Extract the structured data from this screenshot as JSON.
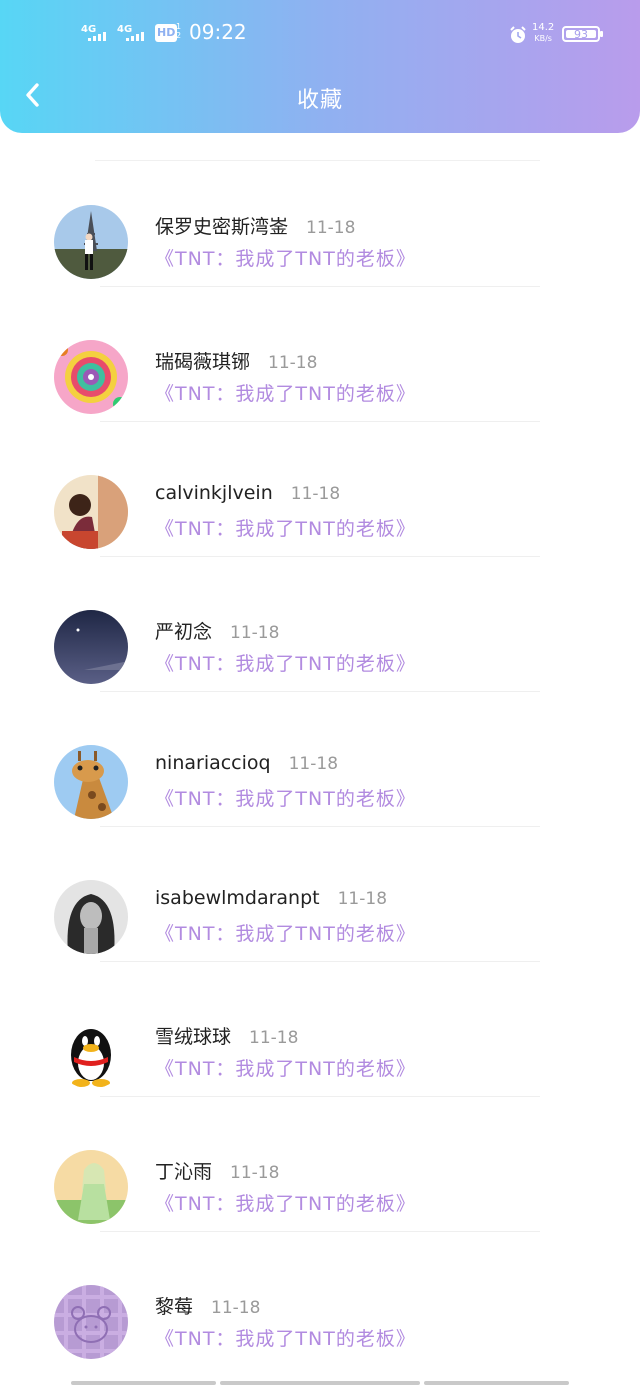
{
  "status_bar": {
    "signal1": "4G",
    "signal2": "4G",
    "hd": "HD",
    "hd_sub": "1\n2",
    "time": "09:22",
    "speed_value": "14.2",
    "speed_unit": "KB/s",
    "battery": "93"
  },
  "header": {
    "title": "收藏"
  },
  "items": [
    {
      "name": "保罗史密斯湾崟",
      "date": "11-18",
      "book": "《TNT：我成了TNT的老板》",
      "avatar": "eiffel-tower-photo"
    },
    {
      "name": "瑞碣薇琪铘",
      "date": "11-18",
      "book": "《TNT：我成了TNT的老板》",
      "avatar": "lollipop-photo"
    },
    {
      "name": "calvinkjlvein",
      "date": "11-18",
      "book": "《TNT：我成了TNT的老板》",
      "avatar": "girl-reading-photo"
    },
    {
      "name": "严初念",
      "date": "11-18",
      "book": "《TNT：我成了TNT的老板》",
      "avatar": "night-sky-photo"
    },
    {
      "name": "ninariaccioq",
      "date": "11-18",
      "book": "《TNT：我成了TNT的老板》",
      "avatar": "giraffe-photo"
    },
    {
      "name": "isabewlmdaranpt",
      "date": "11-18",
      "book": "《TNT：我成了TNT的老板》",
      "avatar": "bw-woman-photo"
    },
    {
      "name": "雪绒球球",
      "date": "11-18",
      "book": "《TNT：我成了TNT的老板》",
      "avatar": "qq-penguin-icon"
    },
    {
      "name": "丁沁雨",
      "date": "11-18",
      "book": "《TNT：我成了TNT的老板》",
      "avatar": "anime-girl-photo"
    },
    {
      "name": "黎莓",
      "date": "11-18",
      "book": "《TNT：我成了TNT的老板》",
      "avatar": "plaid-bear-photo"
    }
  ]
}
